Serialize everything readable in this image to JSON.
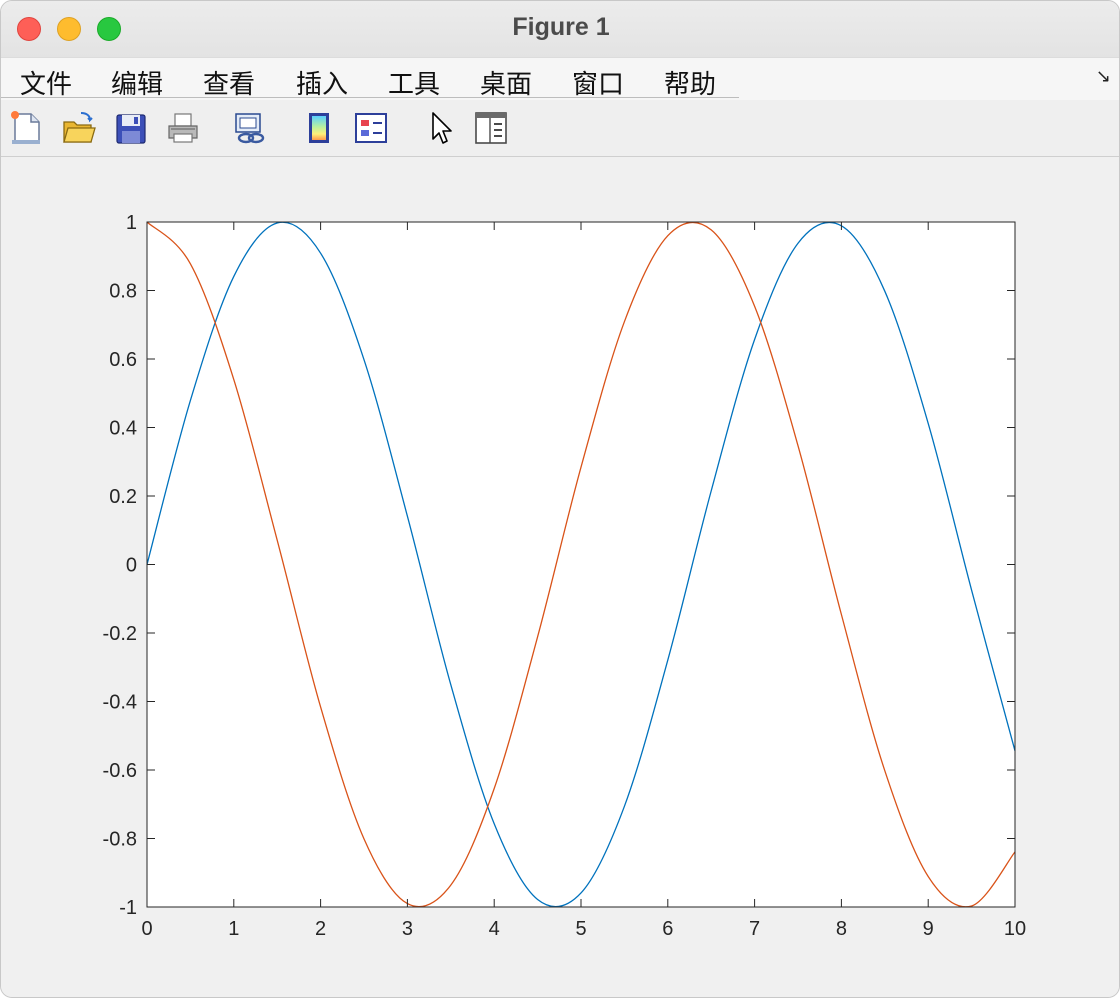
{
  "window": {
    "title": "Figure 1"
  },
  "menu": {
    "items": [
      "文件",
      "编辑",
      "查看",
      "插入",
      "工具",
      "桌面",
      "窗口",
      "帮助"
    ],
    "overflow_icon": "dock-arrow-icon"
  },
  "toolbar": {
    "tools": [
      {
        "name": "new-figure-icon"
      },
      {
        "name": "open-file-icon"
      },
      {
        "name": "save-icon"
      },
      {
        "name": "print-icon"
      },
      {
        "name": "link-plot-icon"
      },
      {
        "name": "insert-colorbar-icon"
      },
      {
        "name": "insert-legend-icon"
      },
      {
        "name": "edit-plot-cursor-icon"
      },
      {
        "name": "property-inspector-icon"
      }
    ]
  },
  "colors": {
    "series1": "#0072BD",
    "series2": "#D95319"
  },
  "chart_data": {
    "type": "line",
    "title": "",
    "xlabel": "",
    "ylabel": "",
    "xlim": [
      0,
      10
    ],
    "ylim": [
      -1,
      1
    ],
    "xticks": [
      0,
      1,
      2,
      3,
      4,
      5,
      6,
      7,
      8,
      9,
      10
    ],
    "yticks": [
      -1,
      -0.8,
      -0.6,
      -0.4,
      -0.2,
      0,
      0.2,
      0.4,
      0.6,
      0.8,
      1
    ],
    "ytick_labels": [
      "-1",
      "-0.8",
      "-0.6",
      "-0.4",
      "-0.2",
      "0",
      "0.2",
      "0.4",
      "0.6",
      "0.8",
      "1"
    ],
    "grid": false,
    "x": [
      0,
      0.5,
      1,
      1.5,
      2,
      2.5,
      3,
      3.5,
      4,
      4.5,
      5,
      5.5,
      6,
      6.5,
      7,
      7.5,
      8,
      8.5,
      9,
      9.5,
      10
    ],
    "series": [
      {
        "color": "#0072BD",
        "values": [
          0,
          0.479,
          0.841,
          0.997,
          0.909,
          0.598,
          0.141,
          -0.351,
          -0.757,
          -0.978,
          -0.959,
          -0.706,
          -0.279,
          0.215,
          0.657,
          0.938,
          0.989,
          0.798,
          0.412,
          -0.075,
          -0.544
        ]
      },
      {
        "color": "#D95319",
        "values": [
          1,
          0.878,
          0.54,
          0.071,
          -0.416,
          -0.801,
          -0.99,
          -0.936,
          -0.654,
          -0.211,
          0.284,
          0.709,
          0.96,
          0.977,
          0.754,
          0.347,
          -0.146,
          -0.602,
          -0.911,
          -0.997,
          -0.839
        ]
      }
    ]
  }
}
